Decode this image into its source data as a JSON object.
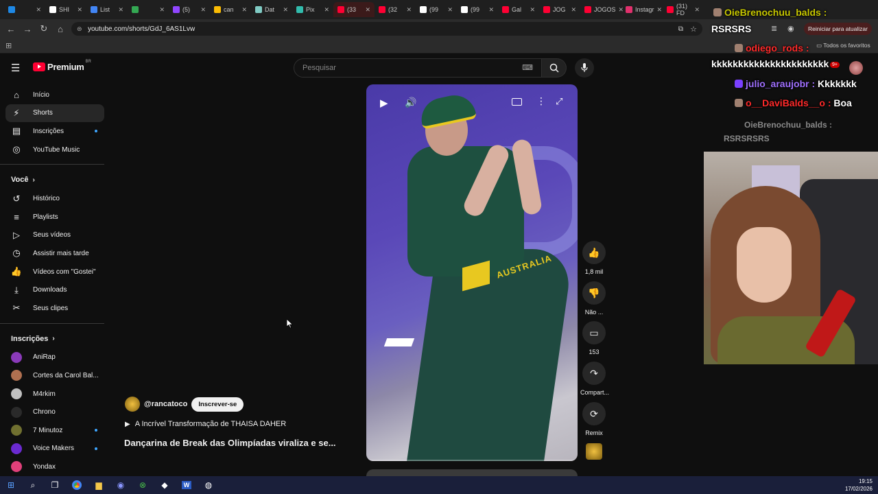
{
  "tabs": [
    {
      "label": "",
      "color": "#1e88e5"
    },
    {
      "label": "SHI",
      "color": "#ffffff"
    },
    {
      "label": "List",
      "color": "#4285f4"
    },
    {
      "label": "",
      "color": "#34a853"
    },
    {
      "label": "(5)",
      "color": "#9146ff"
    },
    {
      "label": "can",
      "color": "#fbbc04"
    },
    {
      "label": "Dat",
      "color": "#80cbc4"
    },
    {
      "label": "Pix",
      "color": "#32bcad"
    },
    {
      "label": "(33",
      "color": "#ff0033"
    },
    {
      "label": "(32",
      "color": "#ff0033"
    },
    {
      "label": "(99",
      "color": "#ffffff"
    },
    {
      "label": "(99",
      "color": "#ffffff"
    },
    {
      "label": "Gal",
      "color": "#ff0033"
    },
    {
      "label": "JOG",
      "color": "#ff0033"
    },
    {
      "label": "JOGOS",
      "color": "#ff0033"
    },
    {
      "label": "Instagr",
      "color": "#e1306c"
    },
    {
      "label": "(31) FD",
      "color": "#ff0033"
    }
  ],
  "browser": {
    "url": "youtube.com/shorts/GdJ_6AS1Lvw",
    "restart_label": "Reiniciar para atualizar",
    "all_favorites": "Todos os favoritos"
  },
  "yt": {
    "logo": "Premium",
    "logo_badge": "BR",
    "search_placeholder": "Pesquisar"
  },
  "sidebar": {
    "main": [
      {
        "label": "Início",
        "icon": "home-icon",
        "glyph": "⌂"
      },
      {
        "label": "Shorts",
        "icon": "shorts-icon",
        "glyph": "⚡"
      },
      {
        "label": "Inscrições",
        "icon": "subscriptions-icon",
        "glyph": "▤"
      },
      {
        "label": "YouTube Music",
        "icon": "music-icon",
        "glyph": "◎"
      }
    ],
    "you_header": "Você",
    "you": [
      {
        "label": "Histórico",
        "icon": "history-icon",
        "glyph": "↺"
      },
      {
        "label": "Playlists",
        "icon": "playlists-icon",
        "glyph": "≡"
      },
      {
        "label": "Seus vídeos",
        "icon": "your-videos-icon",
        "glyph": "▷"
      },
      {
        "label": "Assistir mais tarde",
        "icon": "watch-later-icon",
        "glyph": "◷"
      },
      {
        "label": "Vídeos com \"Gostei\"",
        "icon": "liked-icon",
        "glyph": "👍"
      },
      {
        "label": "Downloads",
        "icon": "download-icon",
        "glyph": "⤓"
      },
      {
        "label": "Seus clipes",
        "icon": "clips-icon",
        "glyph": "✂"
      }
    ],
    "subs_header": "Inscrições",
    "subs": [
      {
        "label": "AniRap",
        "color": "#8a3ab9"
      },
      {
        "label": "Cortes da Carol Bal...",
        "color": "#b07050"
      },
      {
        "label": "M4rkim",
        "color": "#c0c0c0"
      },
      {
        "label": "Chrono",
        "color": "#2a2a2a"
      },
      {
        "label": "7 Minutoz",
        "color": "#707030"
      },
      {
        "label": "Voice Makers",
        "color": "#6a2ad0"
      },
      {
        "label": "Yondax",
        "color": "#e0407a"
      }
    ]
  },
  "short": {
    "channel": "@rancatoco",
    "subscribe": "Inscrever-se",
    "playlist": "A Incrível Transformação de THAISA DAHER",
    "title": "Dançarina de Break das Olimpíadas viraliza e se...",
    "jersey_text": "AUSTRALIA"
  },
  "actions": {
    "likes": "1,8 mil",
    "dislike": "Não ...",
    "comments": "153",
    "share": "Compart...",
    "remix": "Remix"
  },
  "chat": {
    "lines": [
      {
        "user": "OieBrenochuu_balds :",
        "color": "#c8c800",
        "text": ""
      },
      {
        "user": "RSRSRS",
        "color": "#ffffff",
        "text": ""
      },
      {
        "user": "odiego_rods :",
        "color": "#ff2a2a",
        "text": ""
      },
      {
        "user": "kkkkkkkkkkkkkkkkkkkkkk",
        "color": "#ffffff",
        "text": ""
      },
      {
        "user": "julio_araujobr :",
        "color": "#a070ff",
        "text": " Kkkkkkk"
      },
      {
        "user": "o__DaviBalds__o :",
        "color": "#ff2a2a",
        "text": " Boa"
      }
    ],
    "faded_user": "OieBrenochuu_balds :",
    "faded_text": "RSRSRSRS"
  },
  "taskbar": {
    "time": "19:15",
    "date": "17/02/2026"
  }
}
